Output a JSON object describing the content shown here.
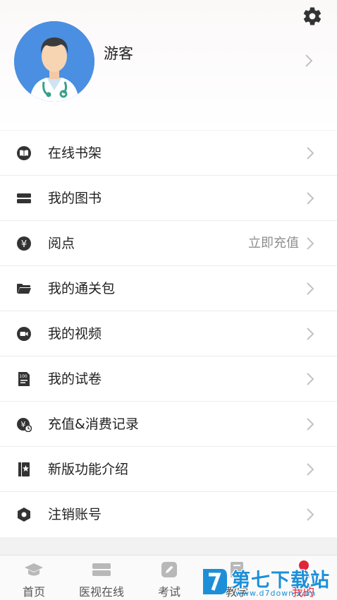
{
  "header": {
    "username": "游客",
    "settings_icon": "gear-icon",
    "avatar": "doctor-avatar"
  },
  "menu": {
    "items": [
      {
        "label": "在线书架",
        "icon": "open-book-icon"
      },
      {
        "label": "我的图书",
        "icon": "books-icon"
      },
      {
        "label": "阅点",
        "icon": "yen-coin-icon",
        "extra": "立即充值"
      },
      {
        "label": "我的通关包",
        "icon": "folder-icon"
      },
      {
        "label": "我的视频",
        "icon": "video-camera-icon"
      },
      {
        "label": "我的试卷",
        "icon": "exam-paper-icon"
      },
      {
        "label": "充值&消费记录",
        "icon": "recharge-record-icon"
      },
      {
        "label": "新版功能介绍",
        "icon": "new-feature-icon"
      },
      {
        "label": "注销账号",
        "icon": "hexagon-icon"
      }
    ]
  },
  "tabbar": {
    "tabs": [
      {
        "label": "首页",
        "icon": "graduation-cap-icon"
      },
      {
        "label": "医视在线",
        "icon": "stack-icon"
      },
      {
        "label": "考试",
        "icon": "pencil-icon"
      },
      {
        "label": "教学",
        "icon": "bookmark-icon"
      },
      {
        "label": "我的",
        "icon": "person-icon",
        "active": true
      }
    ]
  },
  "watermark": {
    "title": "第七下载站",
    "url": "www.d7down.com"
  },
  "colors": {
    "accent": "#e0263b",
    "avatar_bg": "#4a8fe2",
    "watermark": "#1d8fd8"
  }
}
